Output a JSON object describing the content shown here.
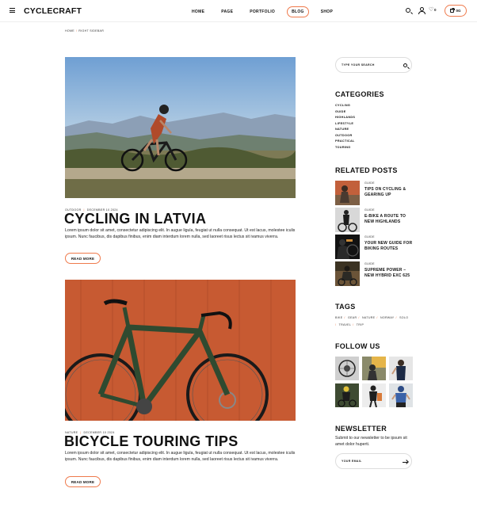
{
  "brand": {
    "logo": "CYCLECRAFT",
    "accent": "#ef7a4c"
  },
  "nav": [
    "HOME",
    "PAGE",
    "PORTFOLIO",
    "BLOG",
    "SHOP"
  ],
  "header": {
    "wishlist_count": "0",
    "cart_label": "0G"
  },
  "breadcrumb": [
    "HOME",
    "RIGHT SIDEBAR"
  ],
  "posts": [
    {
      "category": "OUTDOOR",
      "date": "DECEMBER 10 2024",
      "title": "CYCLING IN LATVIA",
      "excerpt": "Lorem ipsum dolor sit amet, consectetur adipiscing elit. In augue ligula, feugiat ut nulla consequat. Ut est lacus, molestee iculis ipsum. Nunc faucibus, dis dapibus finibus, enim diam interdum lorem nulla, sed laoreet risus lectus sit ivamus viverra.",
      "button": "READ MORE"
    },
    {
      "category": "NATURE",
      "date": "DECEMBER 10 2024",
      "title": "BICYCLE TOURING TIPS",
      "excerpt": "Lorem ipsum dolor sit amet, consectetur adipiscing elit. In augue ligula, feugiat ut nulla consequat. Ut est lacus, molestee iculis ipsum. Nunc faucibus, dis dapibus finibus, enim diam interdum lorem nulla, sed laoreet risus lectus sit ivamus viverra.",
      "button": "READ MORE"
    }
  ],
  "sidebar": {
    "search_placeholder": "TYPE YOUR SEARCH",
    "categories_heading": "CATEGORIES",
    "categories": [
      "CYCLING",
      "GUIDE",
      "HIGHLANDS",
      "LIFESTYLE",
      "NATURE",
      "OUTDOOR",
      "PRACTICAL",
      "TOURING"
    ],
    "related_heading": "RELATED POSTS",
    "related": [
      {
        "category": "GUIDE",
        "title": "TIPS ON CYCLING & GEARING UP"
      },
      {
        "category": "GUIDE",
        "title": "E-BIKE A ROUTE TO NEW HIGHLANDS"
      },
      {
        "category": "GUIDE",
        "title": "YOUR NEW GUIDE FOR BIKING ROUTES"
      },
      {
        "category": "GUIDE",
        "title": "SUPREME POWER – NEW HYBRID EXC 625"
      }
    ],
    "tags_heading": "TAGS",
    "tags": [
      "BIKE",
      "GEAR",
      "NATURE",
      "NORWAY",
      "SOLO",
      "TRAVEL",
      "TRIP"
    ],
    "follow_heading": "FOLLOW US",
    "newsletter_heading": "NEWSLETTER",
    "newsletter_text": "Submit to our newsletter to be ipsum sit amet dolor huperti.",
    "email_placeholder": "YOUR EMAIL"
  }
}
